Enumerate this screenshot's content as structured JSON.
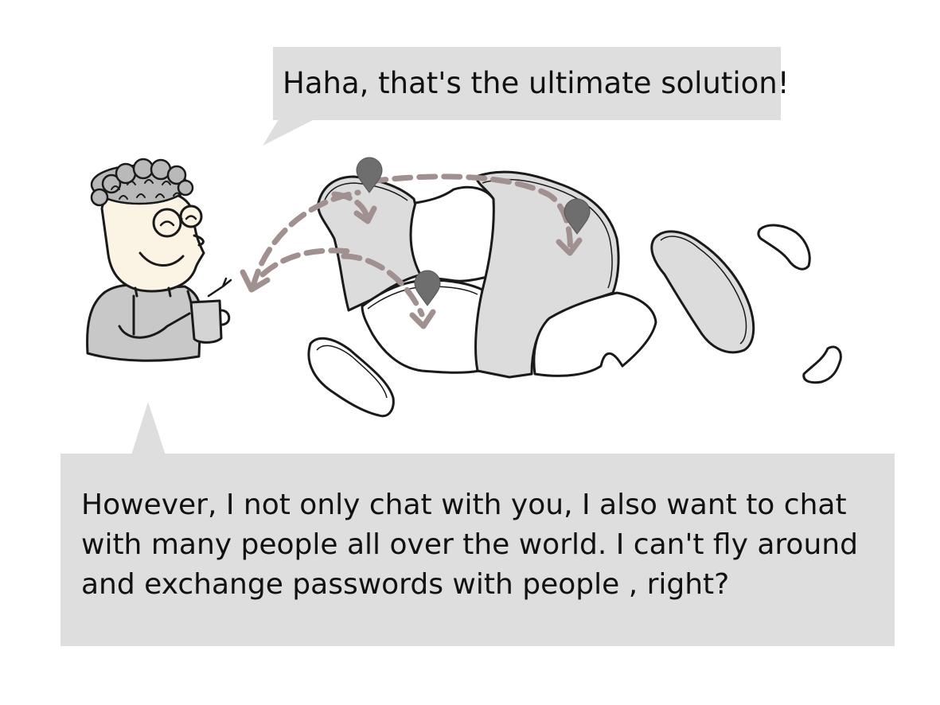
{
  "dialogue": {
    "top_bubble": "Haha, that's the ultimate solution!",
    "bottom_bubble_lines": [
      "However, I not only chat with you, I also want to chat",
      "with many people all over the world. I can't fly around",
      "and exchange passwords with people , right?"
    ]
  },
  "colors": {
    "bubble": "#dedede",
    "land_shaded": "#dcdcdc",
    "arrow": "#a0908f",
    "pin": "#6e6e6e",
    "shirt": "#c8c8c8",
    "skin": "#fbf4e4"
  }
}
